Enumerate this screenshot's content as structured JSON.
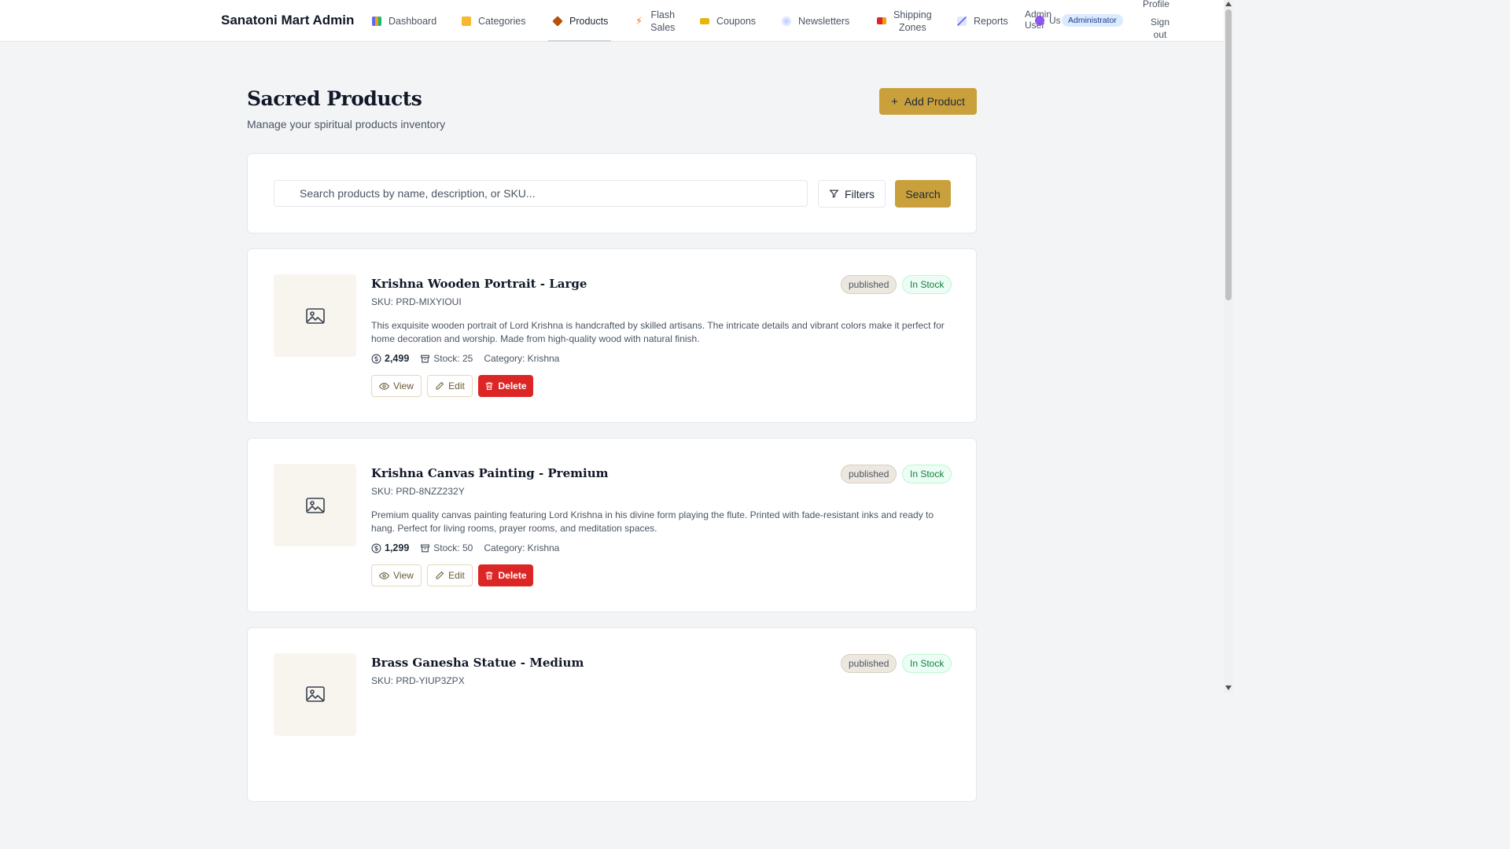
{
  "app": {
    "brand": "Sanatoni Mart Admin"
  },
  "nav": {
    "items": [
      {
        "label": "Dashboard",
        "icon": "chart-icon",
        "color": "#6366f1"
      },
      {
        "label": "Categories",
        "icon": "folder-icon",
        "color": "#f5b82e"
      },
      {
        "label": "Products",
        "icon": "box-icon",
        "color": "#a16207"
      },
      {
        "label": "Flash",
        "label2": "Sales",
        "icon": "lightning-icon",
        "color": "#f97316"
      },
      {
        "label": "Coupons",
        "icon": "ticket-icon",
        "color": "#eab308"
      },
      {
        "label": "Newsletters",
        "icon": "mail-icon",
        "color": "#6366f1"
      },
      {
        "label": "Shipping",
        "label2": "Zones",
        "icon": "truck-icon",
        "color": "#dc2626"
      },
      {
        "label": "Reports",
        "icon": "trend-icon",
        "color": "#6366f1"
      }
    ],
    "active": "Products"
  },
  "user": {
    "name": "Admin User",
    "users_link": "Us",
    "role": "Administrator",
    "profile": "Profile",
    "signout": "Sign out"
  },
  "header": {
    "title": "Sacred Products",
    "subtitle": "Manage your spiritual products inventory",
    "add_button": "Add Product"
  },
  "search": {
    "placeholder": "Search products by name, description, or SKU...",
    "filters_label": "Filters",
    "search_label": "Search"
  },
  "products": [
    {
      "name": "Krishna Wooden Portrait - Large",
      "sku": "SKU: PRD-MIXYIOUI",
      "description": "This exquisite wooden portrait of Lord Krishna is handcrafted by skilled artisans. The intricate details and vibrant colors make it perfect for home decoration and worship. Made from high-quality wood with natural finish.",
      "price": "2,499",
      "stock": "Stock: 25",
      "category": "Category: Krishna",
      "status": "published",
      "stock_status": "In Stock"
    },
    {
      "name": "Krishna Canvas Painting - Premium",
      "sku": "SKU: PRD-8NZZ232Y",
      "description": "Premium quality canvas painting featuring Lord Krishna in his divine form playing the flute. Printed with fade-resistant inks and ready to hang. Perfect for living rooms, prayer rooms, and meditation spaces.",
      "price": "1,299",
      "stock": "Stock: 50",
      "category": "Category: Krishna",
      "status": "published",
      "stock_status": "In Stock"
    },
    {
      "name": "Brass Ganesha Statue - Medium",
      "sku": "SKU: PRD-YIUP3ZPX",
      "description": "",
      "price": "",
      "stock": "",
      "category": "",
      "status": "published",
      "stock_status": "In Stock"
    }
  ],
  "actions": {
    "view": "View",
    "edit": "Edit",
    "delete": "Delete"
  },
  "colors": {
    "accent": "#c9a03c",
    "danger": "#dc2626",
    "success": "#15803d"
  }
}
